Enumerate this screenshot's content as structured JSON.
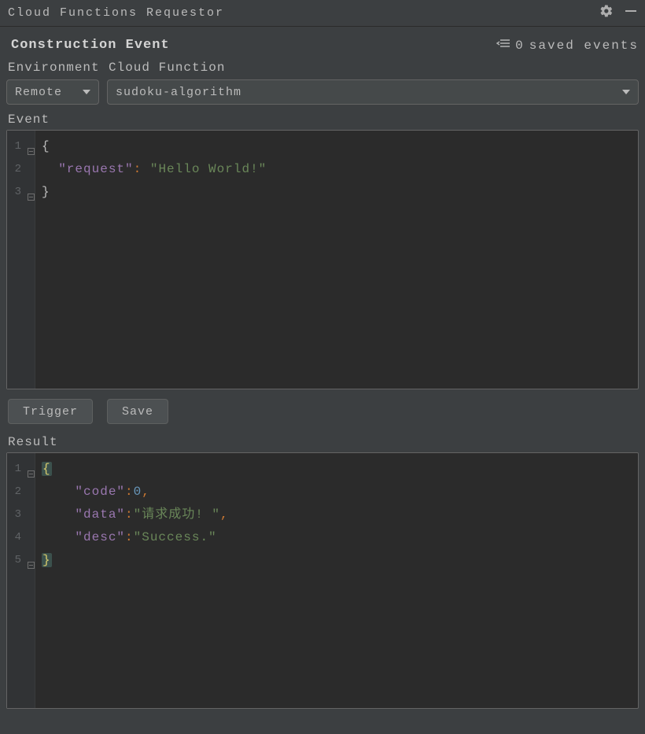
{
  "titlebar": {
    "title": "Cloud Functions Requestor"
  },
  "section": {
    "title": "Construction Event",
    "saved_events_count": "0",
    "saved_events_label": "saved events"
  },
  "labels": {
    "environment": "Environment",
    "cloud_function": "Cloud Function",
    "event": "Event",
    "result": "Result"
  },
  "selects": {
    "environment": "Remote",
    "function": "sudoku-algorithm"
  },
  "buttons": {
    "trigger": "Trigger",
    "save": "Save"
  },
  "event_editor": {
    "lines": [
      {
        "n": "1",
        "tokens": [
          {
            "t": "{",
            "c": "brace"
          }
        ]
      },
      {
        "n": "2",
        "tokens": [
          {
            "t": "  ",
            "c": "plain"
          },
          {
            "t": "\"request\"",
            "c": "key"
          },
          {
            "t": ":",
            "c": "colon"
          },
          {
            "t": " ",
            "c": "plain"
          },
          {
            "t": "\"Hello World!\"",
            "c": "str"
          }
        ]
      },
      {
        "n": "3",
        "tokens": [
          {
            "t": "}",
            "c": "brace"
          }
        ]
      }
    ]
  },
  "result_editor": {
    "lines": [
      {
        "n": "1",
        "tokens": [
          {
            "t": "{",
            "c": "brace-y",
            "hl": true
          }
        ]
      },
      {
        "n": "2",
        "tokens": [
          {
            "t": "    ",
            "c": "plain"
          },
          {
            "t": "\"code\"",
            "c": "key"
          },
          {
            "t": ":",
            "c": "colon"
          },
          {
            "t": "0",
            "c": "num"
          },
          {
            "t": ",",
            "c": "comma"
          }
        ]
      },
      {
        "n": "3",
        "tokens": [
          {
            "t": "    ",
            "c": "plain"
          },
          {
            "t": "\"data\"",
            "c": "key"
          },
          {
            "t": ":",
            "c": "colon"
          },
          {
            "t": "\"请求成功! \"",
            "c": "str"
          },
          {
            "t": ",",
            "c": "comma"
          }
        ]
      },
      {
        "n": "4",
        "tokens": [
          {
            "t": "    ",
            "c": "plain"
          },
          {
            "t": "\"desc\"",
            "c": "key"
          },
          {
            "t": ":",
            "c": "colon"
          },
          {
            "t": "\"Success.\"",
            "c": "str"
          }
        ]
      },
      {
        "n": "5",
        "tokens": [
          {
            "t": "}",
            "c": "brace-y",
            "hl": true
          }
        ]
      }
    ]
  }
}
